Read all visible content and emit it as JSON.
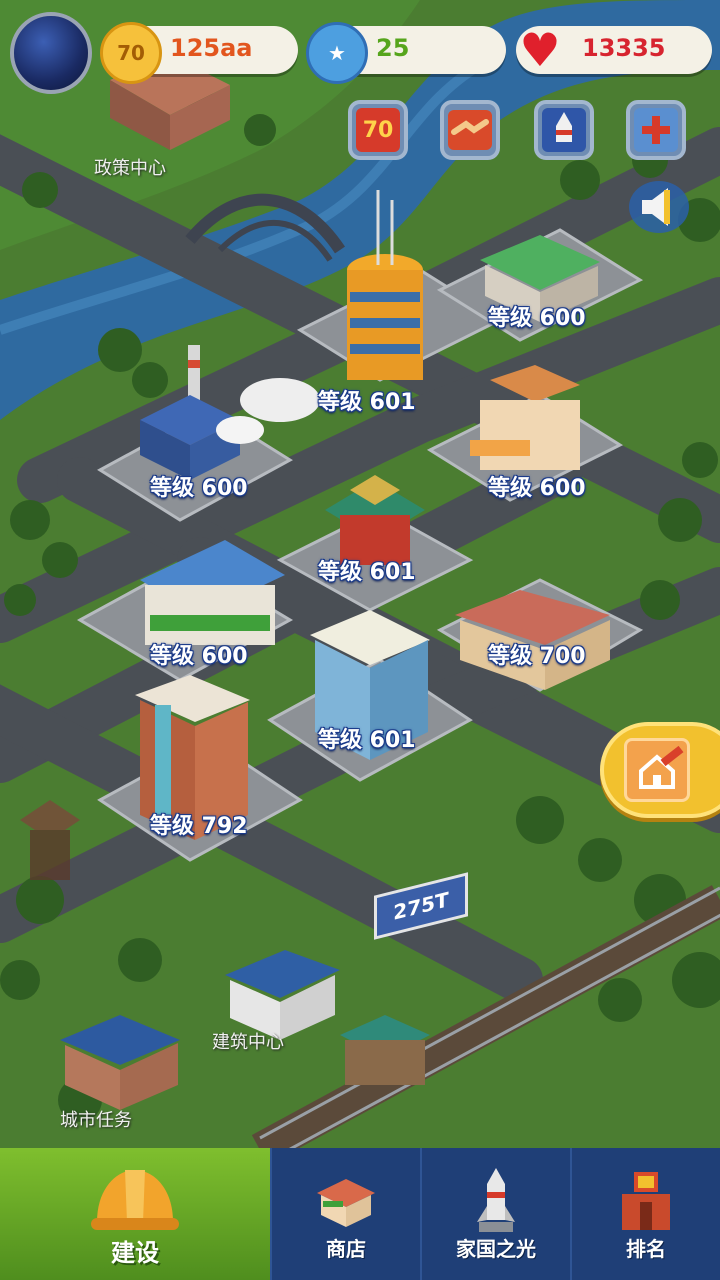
{
  "resources": {
    "coins": "125aa",
    "coin_badge": "70",
    "stars": "25",
    "hearts": "13335"
  },
  "colors": {
    "coin_text": "#e2561e",
    "star_text": "#56a51c",
    "heart_text": "#d7242f",
    "nav_active": "#6aa824",
    "nav_bg": "#1f3f77"
  },
  "event_icons": [
    {
      "name": "anniversary-70-icon",
      "text": "70"
    },
    {
      "name": "handshake-icon"
    },
    {
      "name": "rocket-icon"
    },
    {
      "name": "rescue-icon"
    }
  ],
  "map_labels": {
    "policy_center": "政策中心",
    "building_center": "建筑中心",
    "city_tasks": "城市任务"
  },
  "buildings": [
    {
      "name": "office-tower",
      "level": "等级 601"
    },
    {
      "name": "farm-house",
      "level": "等级 600"
    },
    {
      "name": "power-plant",
      "level": "等级 600"
    },
    {
      "name": "cafe",
      "level": "等级 600"
    },
    {
      "name": "pagoda-hall",
      "level": "等级 601"
    },
    {
      "name": "vegetable-market",
      "level": "等级 600"
    },
    {
      "name": "old-house",
      "level": "等级 700"
    },
    {
      "name": "blue-office",
      "level": "等级 601"
    },
    {
      "name": "brick-apartment",
      "level": "等级 792"
    }
  ],
  "billboard": "275T",
  "nav": {
    "tabs": [
      {
        "label": "建设",
        "icon": "hard-hat-icon"
      },
      {
        "label": "商店",
        "icon": "shop-icon"
      },
      {
        "label": "家国之光",
        "icon": "rocket-icon"
      },
      {
        "label": "排名",
        "icon": "ranking-icon"
      }
    ]
  }
}
